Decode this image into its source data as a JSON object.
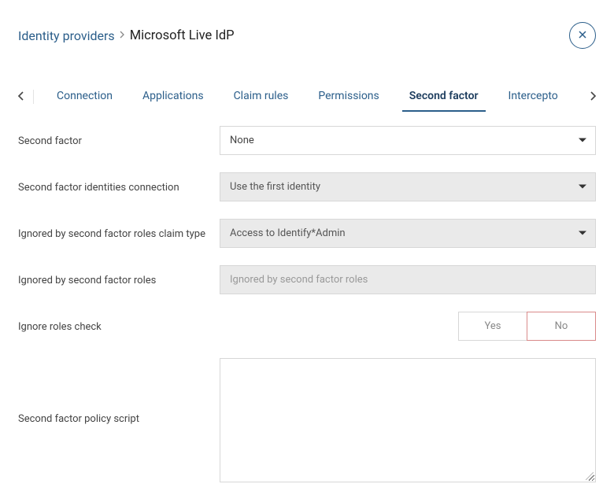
{
  "breadcrumb": {
    "parent": "Identity providers",
    "current": "Microsoft Live IdP"
  },
  "tabs": {
    "items": [
      "Connection",
      "Applications",
      "Claim rules",
      "Permissions",
      "Second factor",
      "Intercepto"
    ],
    "active": 4
  },
  "form": {
    "second_factor": {
      "label": "Second factor",
      "value": "None"
    },
    "identities_connection": {
      "label": "Second factor identities connection",
      "value": "Use the first identity"
    },
    "ignored_roles_claim_type": {
      "label": "Ignored by second factor roles claim type",
      "value": "Access to Identify*Admin"
    },
    "ignored_roles": {
      "label": "Ignored by second factor roles",
      "placeholder": "Ignored by second factor roles"
    },
    "ignore_roles_check": {
      "label": "Ignore roles check",
      "yes": "Yes",
      "no": "No",
      "selected": "no"
    },
    "policy_script": {
      "label": "Second factor policy script",
      "value": ""
    }
  }
}
